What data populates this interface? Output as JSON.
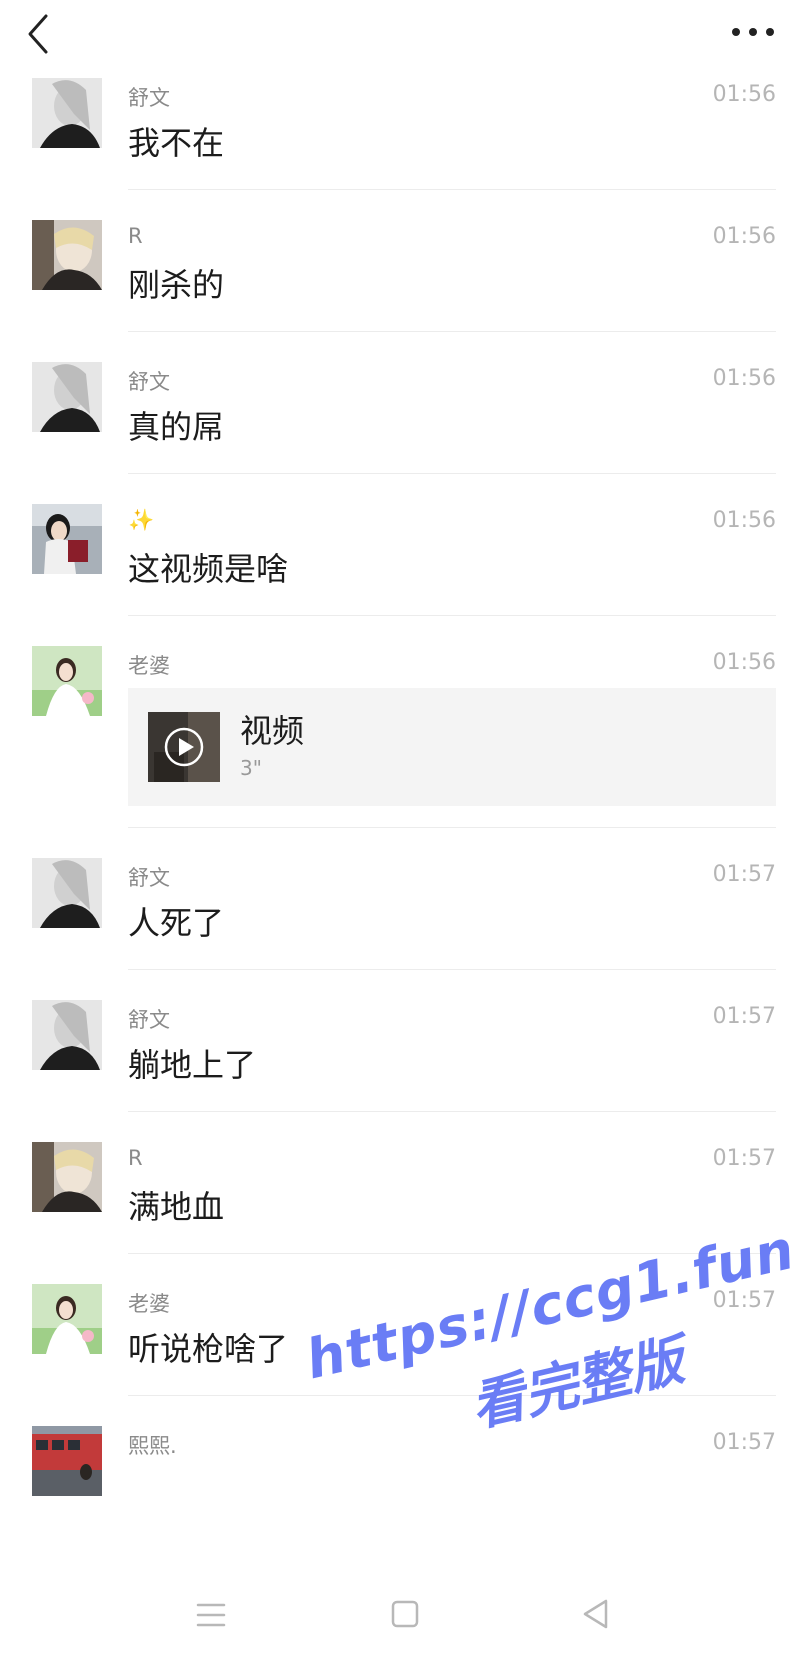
{
  "header": {
    "back_icon": "chevron-left-icon",
    "more_icon": "more-dots-icon"
  },
  "messages": [
    {
      "sender": "舒文",
      "time": "01:56",
      "text": "我不在",
      "avatar": "grayscale-girl"
    },
    {
      "sender": "R",
      "time": "01:56",
      "text": "刚杀的",
      "avatar": "blonde-selfie"
    },
    {
      "sender": "舒文",
      "time": "01:56",
      "text": "真的屌",
      "avatar": "grayscale-girl"
    },
    {
      "sender": "✨",
      "time": "01:56",
      "text": "这视频是啥",
      "avatar": "girl-red-outfit"
    },
    {
      "sender": "老婆",
      "time": "01:56",
      "video": {
        "title": "视频",
        "duration": "3\""
      },
      "avatar": "bride-green"
    },
    {
      "sender": "舒文",
      "time": "01:57",
      "text": "人死了",
      "avatar": "grayscale-girl"
    },
    {
      "sender": "舒文",
      "time": "01:57",
      "text": "躺地上了",
      "avatar": "grayscale-girl"
    },
    {
      "sender": "R",
      "time": "01:57",
      "text": "满地血",
      "avatar": "blonde-selfie"
    },
    {
      "sender": "老婆",
      "time": "01:57",
      "text": "听说枪啥了",
      "avatar": "bride-green"
    },
    {
      "sender": "熙熙.",
      "time": "01:57",
      "text": "",
      "avatar": "city-street"
    }
  ],
  "watermark": {
    "line1": "https://ccg1.fun",
    "line2": "看完整版"
  },
  "navbar": {
    "menu_icon": "menu-lines-icon",
    "home_icon": "square-home-icon",
    "back_icon": "triangle-back-icon"
  }
}
